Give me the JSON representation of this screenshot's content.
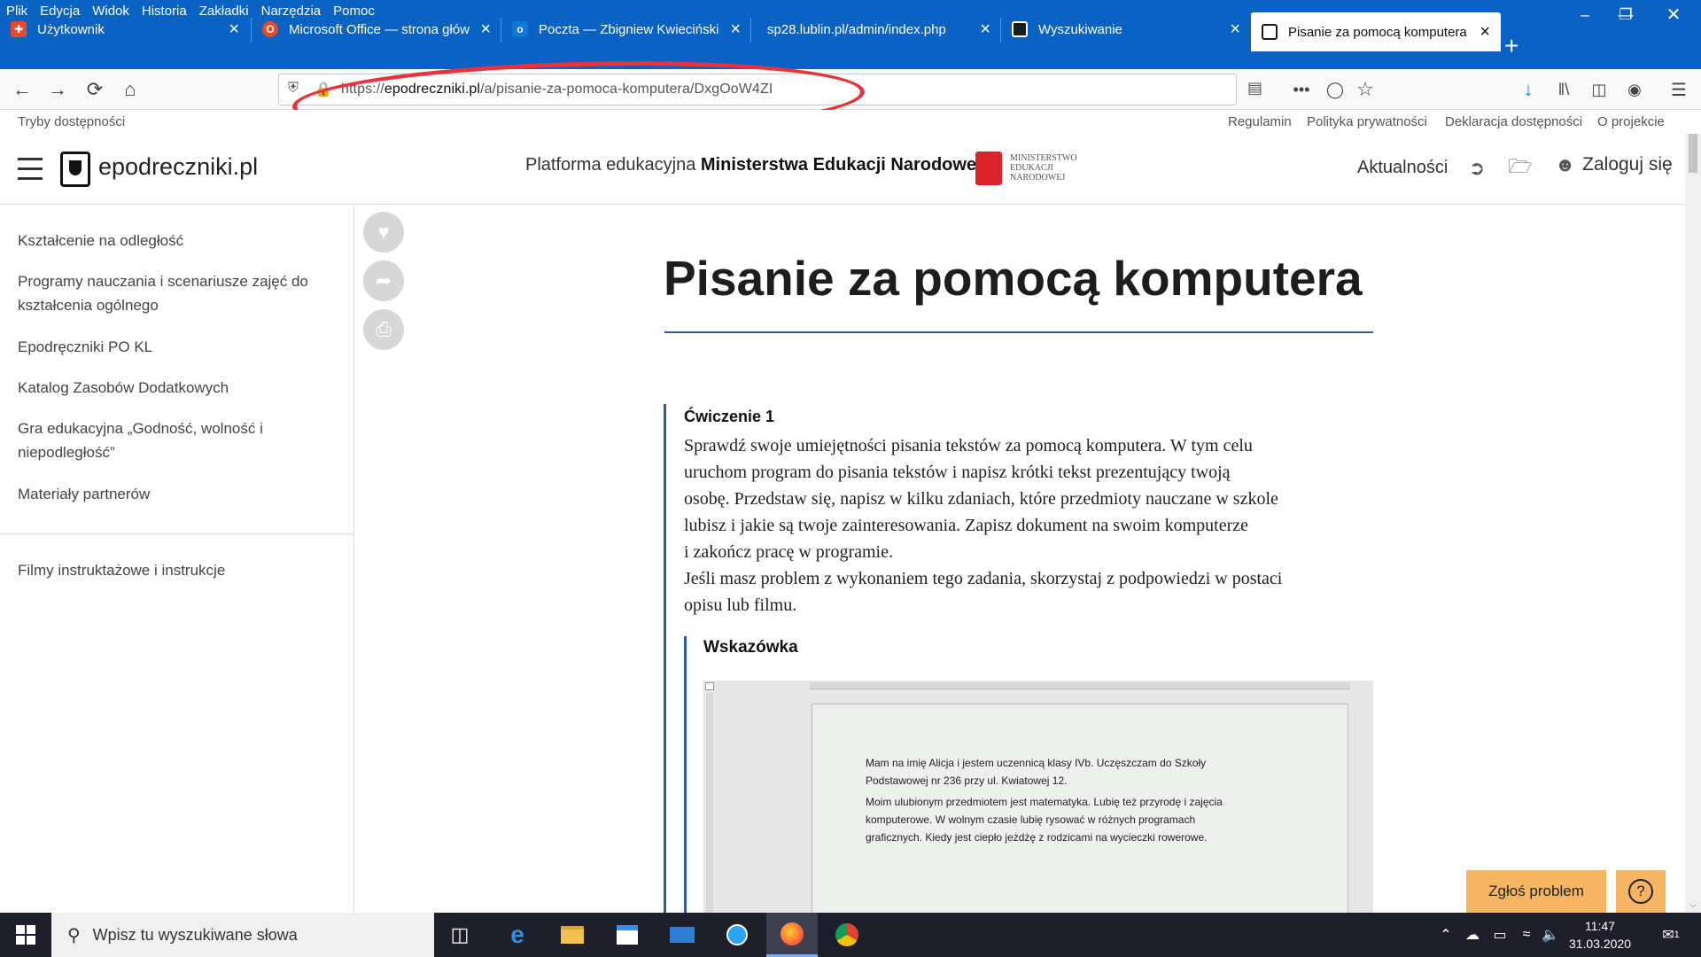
{
  "menu": [
    "Plik",
    "Edycja",
    "Widok",
    "Historia",
    "Zakładki",
    "Narzędzia",
    "Pomoc"
  ],
  "tabs": [
    {
      "title": "Użytkownik",
      "icon": "user-icon",
      "color": "#e8482b"
    },
    {
      "title": "Microsoft Office — strona głów",
      "icon": "office-icon",
      "color": "#e34c26"
    },
    {
      "title": "Poczta — Zbigniew Kwieciński",
      "icon": "outlook-icon",
      "color": "#0f78d4"
    },
    {
      "title": "sp28.lublin.pl/admin/index.php",
      "icon": "",
      "color": ""
    },
    {
      "title": "Wyszukiwanie",
      "icon": "epodreczniki-icon",
      "color": "#1b1b1b"
    },
    {
      "title": "Pisanie za pomocą komputera",
      "icon": "epodreczniki-icon",
      "color": "#1b1b1b"
    }
  ],
  "url": {
    "prefix": "https://",
    "domain": "epodreczniki.pl",
    "path": "/a/pisanie-za-pomoca-komputera/DxgOoW4ZI"
  },
  "topLinks": {
    "left": "Tryby dostępności",
    "right": [
      "Regulamin",
      "Polityka prywatności",
      "Deklaracja dostępności",
      "O projekcie"
    ]
  },
  "site": {
    "logo": "epodreczniki.pl",
    "platformPrefix": "Platforma edukacyjna",
    "platformBold": "Ministerstwa Edukacji Narodowej",
    "ministry": [
      "MINISTERSTWO",
      "EDUKACJI",
      "NARODOWEJ"
    ],
    "news": "Aktualności",
    "login": "Zaloguj się"
  },
  "sidebar": [
    "Kształcenie na odległość",
    "Programy nauczania i scenariusze zajęć do kształcenia ogólnego",
    "Epodręczniki PO KL",
    "Katalog Zasobów Dodatkowych",
    "Gra edukacyjna „Godność, wolność i niepodległość”",
    "Materiały partnerów",
    "Filmy instruktażowe i instrukcje"
  ],
  "article": {
    "title": "Pisanie za pomocą komputera",
    "exerciseTitle": "Ćwiczenie 1",
    "exerciseLines": [
      "Sprawdź swoje umiejętności pisania tekstów za pomocą komputera. W tym celu",
      "uruchom program do pisania tekstów i napisz krótki tekst prezentujący twoją",
      "osobę. Przedstaw się, napisz w kilku zdaniach, które przedmioty nauczane w szkole",
      "lubisz i jakie są twoje zainteresowania. Zapisz dokument na swoim komputerze",
      "i zakończ pracę w programie.",
      "Jeśli masz problem z wykonaniem tego zadania, skorzystaj z podpowiedzi w postaci",
      "opisu lub filmu."
    ],
    "hintTitle": "Wskazówka",
    "docLines": [
      "Mam na imię Alicja i jestem uczennicą klasy IVb. Uczęszczam do Szkoły",
      "Podstawowej nr 236 przy ul. Kwiatowej 12.",
      "Moim ulubionym przedmiotem jest matematyka. Lubię też przyrodę i zajęcia",
      "komputerowe. W wolnym czasie lubię rysować w różnych programach",
      "graficznych. Kiedy jest ciepło jeżdżę z rodzicami na wycieczki rowerowe."
    ]
  },
  "buttons": {
    "report": "Zgłoś problem",
    "help": "?"
  },
  "taskbar": {
    "search": "Wpisz tu wyszukiwane słowa",
    "time": "11:47",
    "date": "31.03.2020",
    "notifications": "1"
  }
}
